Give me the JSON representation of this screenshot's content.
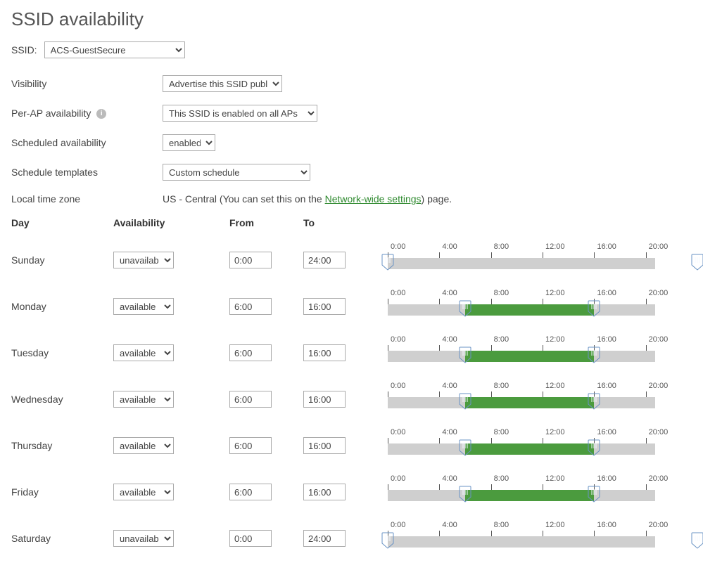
{
  "page_title": "SSID availability",
  "ssid": {
    "label": "SSID:",
    "selected": "ACS-GuestSecure"
  },
  "visibility": {
    "label": "Visibility",
    "selected": "Advertise this SSID publicly"
  },
  "per_ap": {
    "label": "Per-AP availability",
    "selected": "This SSID is enabled on all APs"
  },
  "sched_avail": {
    "label": "Scheduled availability",
    "selected": "enabled"
  },
  "templates": {
    "label": "Schedule templates",
    "selected": "Custom schedule"
  },
  "tz": {
    "label": "Local time zone",
    "prefix": "US - Central (You can set this on the ",
    "link": "Network-wide settings",
    "suffix": ") page."
  },
  "headers": {
    "day": "Day",
    "availability": "Availability",
    "from": "From",
    "to": "To"
  },
  "tick_labels": [
    "0:00",
    "4:00",
    "8:00",
    "12:00",
    "16:00",
    "20:00"
  ],
  "days": [
    {
      "name": "Sunday",
      "availability": "unavailable",
      "from": "0:00",
      "to": "24:00",
      "from_h": 0,
      "to_h": 24
    },
    {
      "name": "Monday",
      "availability": "available",
      "from": "6:00",
      "to": "16:00",
      "from_h": 6,
      "to_h": 16
    },
    {
      "name": "Tuesday",
      "availability": "available",
      "from": "6:00",
      "to": "16:00",
      "from_h": 6,
      "to_h": 16
    },
    {
      "name": "Wednesday",
      "availability": "available",
      "from": "6:00",
      "to": "16:00",
      "from_h": 6,
      "to_h": 16
    },
    {
      "name": "Thursday",
      "availability": "available",
      "from": "6:00",
      "to": "16:00",
      "from_h": 6,
      "to_h": 16
    },
    {
      "name": "Friday",
      "availability": "available",
      "from": "6:00",
      "to": "16:00",
      "from_h": 6,
      "to_h": 16
    },
    {
      "name": "Saturday",
      "availability": "unavailable",
      "from": "0:00",
      "to": "24:00",
      "from_h": 0,
      "to_h": 24
    }
  ]
}
